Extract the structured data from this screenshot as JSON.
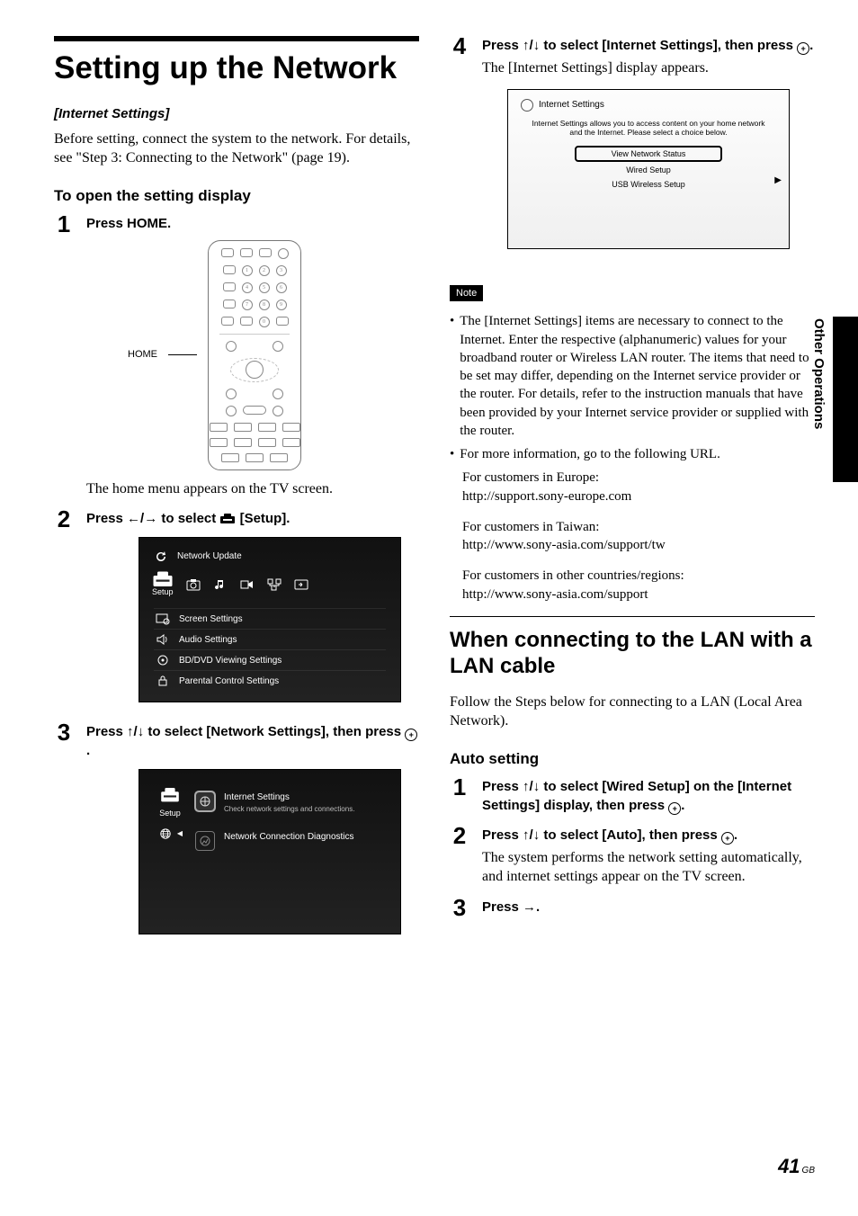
{
  "sideTab": "Other Operations",
  "pageNumber": "41",
  "pageLocale": "GB",
  "left": {
    "title": "Setting up the Network",
    "sub1": "[Internet Settings]",
    "intro": "Before setting, connect the system to the network. For details, see \"Step 3: Connecting to the Network\" (page 19).",
    "openHead": "To open the setting display",
    "steps": {
      "s1": {
        "num": "1",
        "bold": "Press HOME.",
        "bodyAfter": "The home menu appears on the TV screen."
      },
      "s2": {
        "num": "2",
        "boldA": "Press ",
        "arrows": "←/→",
        "boldB": " to select ",
        "boldC": " [Setup]."
      },
      "s3": {
        "num": "3",
        "boldA": "Press ",
        "arrows": "↑/↓",
        "boldB": " to select [Network Settings], then press ",
        "boldC": "."
      }
    },
    "remoteLabel": "HOME",
    "setupCard": {
      "topItem": "Network Update",
      "leftLabel": "Setup",
      "items": [
        "Screen Settings",
        "Audio Settings",
        "BD/DVD Viewing Settings",
        "Parental Control Settings"
      ]
    },
    "netCard": {
      "leftLabel": "Setup",
      "item1": {
        "title": "Internet Settings",
        "sub": "Check network settings and connections."
      },
      "item2": {
        "title": "Network Connection Diagnostics"
      }
    }
  },
  "right": {
    "s4": {
      "num": "4",
      "boldA": "Press ",
      "arrows": "↑/↓",
      "boldB": " to select [Internet Settings], then press ",
      "boldC": ".",
      "body": "The [Internet Settings] display appears."
    },
    "wc": {
      "title": "Internet Settings",
      "desc1": "Internet Settings allows you to access content on your home network",
      "desc2": "and the Internet. Please select a choice below.",
      "opt1": "View Network Status",
      "opt2": "Wired Setup",
      "opt3": "USB Wireless Setup"
    },
    "noteLabel": "Note",
    "noteBullets": [
      "The [Internet Settings] items are necessary to connect to the Internet. Enter the respective (alphanumeric) values for your broadband router or Wireless LAN router. The items that need to be set may differ, depending on the Internet service provider or the router. For details, refer to the instruction manuals that have been provided by your Internet service provider or supplied with the router.",
      "For more information, go to the following URL."
    ],
    "urls": {
      "eu1": "For customers in Europe:",
      "eu2": "http://support.sony-europe.com",
      "tw1": "For customers in Taiwan:",
      "tw2": "http://www.sony-asia.com/support/tw",
      "ot1": "For customers in other countries/regions:",
      "ot2": "http://www.sony-asia.com/support"
    },
    "lanHead": "When connecting to the LAN with a LAN cable",
    "lanIntro": "Follow the Steps below for connecting to a LAN (Local Area Network).",
    "autoHead": "Auto setting",
    "autoSteps": {
      "s1": {
        "num": "1",
        "boldA": "Press ",
        "arrows": "↑/↓",
        "boldB": " to select [Wired Setup] on the [Internet Settings] display, then press ",
        "boldC": "."
      },
      "s2": {
        "num": "2",
        "boldA": "Press ",
        "arrows": "↑/↓",
        "boldB": " to select [Auto], then press ",
        "boldC": ".",
        "body": "The system performs the network setting automatically, and internet settings appear on the TV screen."
      },
      "s3": {
        "num": "3",
        "boldA": "Press ",
        "arrow": "→",
        "boldB": "."
      }
    }
  }
}
